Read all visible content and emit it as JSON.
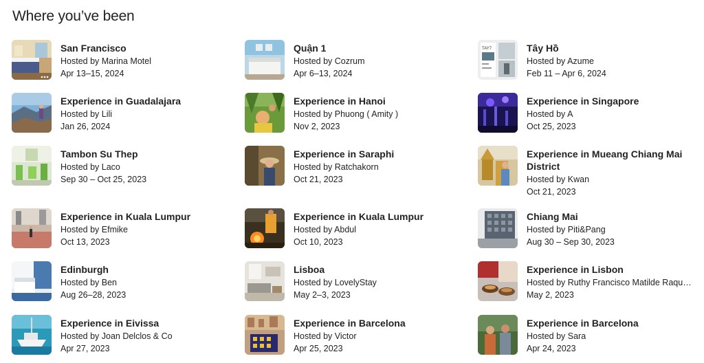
{
  "title": "Where you’ve been",
  "trips": [
    {
      "place": "San Francisco",
      "host": "Hosted by Marina Motel",
      "dates": "Apr 13–15, 2024",
      "thumb": "hotel-room"
    },
    {
      "place": "Quận 1",
      "host": "Hosted by Cozrum",
      "dates": "Apr 6–13, 2024",
      "thumb": "bedroom-blue"
    },
    {
      "place": "Tây Hồ",
      "host": "Hosted by Azume",
      "dates": "Feb 11 – Apr 6, 2024",
      "thumb": "poster"
    },
    {
      "place": "Experience in Guadalajara",
      "host": "Hosted by Lili",
      "dates": "Jan 26, 2024",
      "thumb": "mountain-hiker"
    },
    {
      "place": "Experience in Hanoi",
      "host": "Hosted by Phuong ( Amity )",
      "dates": "Nov 2, 2023",
      "thumb": "jungle-smile"
    },
    {
      "place": "Experience in Singapore",
      "host": "Hosted by A",
      "dates": "Oct 25, 2023",
      "thumb": "night-lights"
    },
    {
      "place": "Tambon Su Thep",
      "host": "Hosted by Laco",
      "dates": "Sep 30 – Oct 25, 2023",
      "thumb": "green-interior"
    },
    {
      "place": "Experience in Saraphi",
      "host": "Hosted by Ratchakorn",
      "dates": "Oct 21, 2023",
      "thumb": "hat-woman"
    },
    {
      "place": "Experience in Mueang Chiang Mai District",
      "host": "Hosted by Kwan",
      "dates": "Oct 21, 2023",
      "thumb": "temple"
    },
    {
      "place": "Experience in Kuala Lumpur",
      "host": "Hosted by Efmike",
      "dates": "Oct 13, 2023",
      "thumb": "plaza"
    },
    {
      "place": "Experience in Kuala Lumpur",
      "host": "Hosted by Abdul",
      "dates": "Oct 10, 2023",
      "thumb": "street-food"
    },
    {
      "place": "Chiang Mai",
      "host": "Hosted by Piti&Pang",
      "dates": "Aug 30 – Sep 30, 2023",
      "thumb": "building"
    },
    {
      "place": "Edinburgh",
      "host": "Hosted by Ben",
      "dates": "Aug 26–28, 2023",
      "thumb": "white-bedroom"
    },
    {
      "place": "Lisboa",
      "host": "Hosted by LovelyStay",
      "dates": "May 2–3, 2023",
      "thumb": "living-room"
    },
    {
      "place": "Experience in Lisbon",
      "host": "Hosted by Ruthy Francisco Matilde Raquel Maria",
      "dates": "May 2, 2023",
      "thumb": "food-bowls"
    },
    {
      "place": "Experience in Eivissa",
      "host": "Hosted by Joan Delclos & Co",
      "dates": "Apr 27, 2023",
      "thumb": "boat"
    },
    {
      "place": "Experience in Barcelona",
      "host": "Hosted by Victor",
      "dates": "Apr 25, 2023",
      "thumb": "city-tiles"
    },
    {
      "place": "Experience in Barcelona",
      "host": "Hosted by Sara",
      "dates": "Apr 24, 2023",
      "thumb": "people-outdoor"
    }
  ]
}
